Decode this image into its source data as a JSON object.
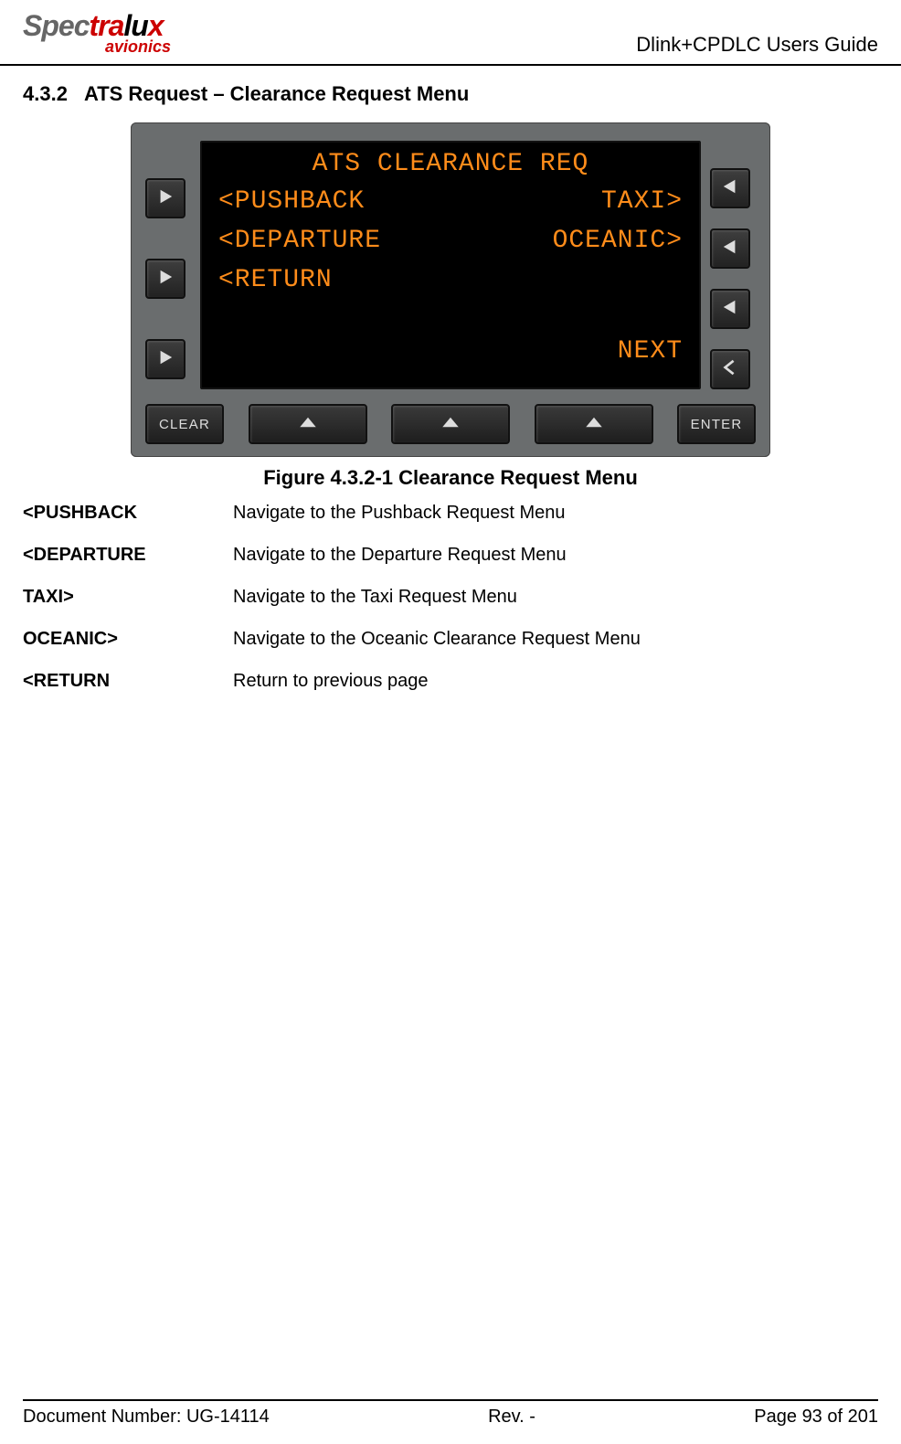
{
  "header": {
    "logo_gray": "Spec",
    "logo_red1": "tra",
    "logo_black": "lu",
    "logo_red2": "x",
    "logo_sub": "avionics",
    "doc_title": "Dlink+CPDLC Users Guide"
  },
  "section": {
    "number": "4.3.2",
    "title": "ATS Request – Clearance Request Menu"
  },
  "device": {
    "screen_title": "ATS CLEARANCE REQ",
    "row1_left": "<PUSHBACK",
    "row1_right": "TAXI>",
    "row2_left": "<DEPARTURE",
    "row2_right": "OCEANIC>",
    "row3_left": "<RETURN",
    "nav_next": "NEXT",
    "btn_clear": "CLEAR",
    "btn_enter": "ENTER"
  },
  "figure_caption": "Figure 4.3.2-1 Clearance Request Menu",
  "definitions": [
    {
      "term": "<PUSHBACK",
      "desc": "Navigate to the Pushback Request Menu"
    },
    {
      "term": "<DEPARTURE",
      "desc": "Navigate to the Departure Request Menu"
    },
    {
      "term": "TAXI>",
      "desc": "Navigate to the Taxi Request Menu"
    },
    {
      "term": "OCEANIC>",
      "desc": "Navigate to the Oceanic Clearance Request Menu"
    },
    {
      "term": "<RETURN",
      "desc": "Return to previous page"
    }
  ],
  "footer": {
    "doc_number": "Document Number:  UG-14114",
    "revision": "Rev. -",
    "page": "Page 93 of 201"
  }
}
